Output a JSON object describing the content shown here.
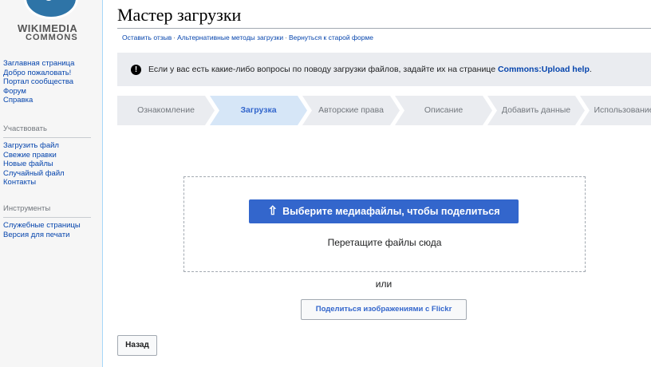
{
  "logo": {
    "line1": "WIKIMEDIA",
    "line2": "COMMONS"
  },
  "sidebar": {
    "main_links": [
      "Заглавная страница",
      "Добро пожаловать!",
      "Портал сообщества",
      "Форум",
      "Справка"
    ],
    "participate_heading": "Участвовать",
    "participate_links": [
      "Загрузить файл",
      "Свежие правки",
      "Новые файлы",
      "Случайный файл",
      "Контакты"
    ],
    "tools_heading": "Инструменты",
    "tools_links": [
      "Служебные страницы",
      "Версия для печати"
    ]
  },
  "page": {
    "title": "Мастер загрузки",
    "sublinks": [
      "Оставить отзыв",
      "Альтернативные методы загрузки",
      "Вернуться к старой форме"
    ],
    "sublink_separator": "·"
  },
  "notice": {
    "icon": "exclamation-icon",
    "icon_glyph": "!",
    "text": "Если у вас есть какие-либо вопросы по поводу загрузки файлов, задайте их на странице ",
    "link": "Commons:Upload help",
    "end": "."
  },
  "steps": [
    {
      "label": "Ознакомление",
      "active": false
    },
    {
      "label": "Загрузка",
      "active": true
    },
    {
      "label": "Авторские права",
      "active": false
    },
    {
      "label": "Описание",
      "active": false
    },
    {
      "label": "Добавить данные",
      "active": false
    },
    {
      "label": "Использование",
      "active": false
    }
  ],
  "upload": {
    "select_button": "Выберите медиафайлы, чтобы поделиться",
    "upload_icon": "upload-icon",
    "drag_text": "Перетащите файлы сюда",
    "or_text": "или",
    "flickr_button": "Поделиться изображениями с Flickr",
    "back_button": "Назад"
  },
  "colors": {
    "accent": "#3366cc",
    "link": "#0645ad",
    "step_active_bg": "#d6e6f7",
    "step_bg": "#eaecf0"
  }
}
